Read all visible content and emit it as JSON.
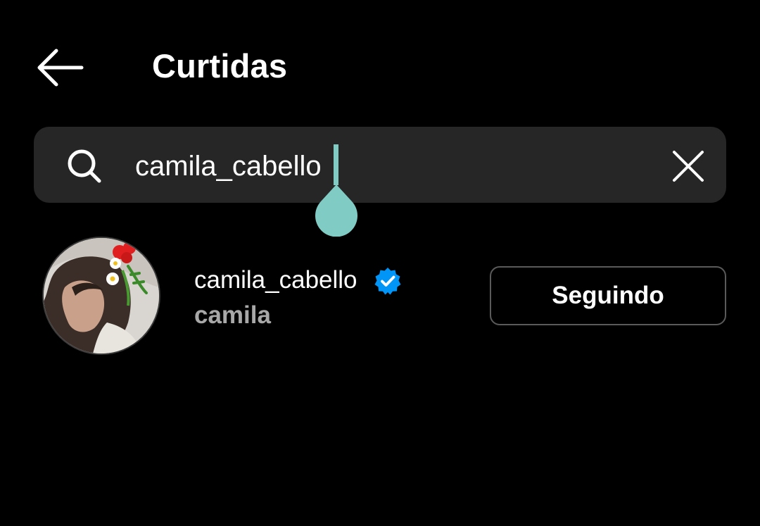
{
  "header": {
    "title": "Curtidas",
    "back_icon": "arrow-left-icon"
  },
  "search": {
    "value": "camila_cabello",
    "search_icon": "search-icon",
    "clear_icon": "close-icon",
    "cursor_color": "#80cbc4"
  },
  "results": [
    {
      "username": "camila_cabello",
      "full_name": "camila",
      "verified": true,
      "verified_icon": "verified-badge-icon",
      "badge_color": "#0095f6",
      "follow_label": "Seguindo"
    }
  ],
  "colors": {
    "background": "#000000",
    "search_bar": "#262626",
    "secondary_text": "#a8a8a8",
    "button_border": "#5a5a5a"
  }
}
